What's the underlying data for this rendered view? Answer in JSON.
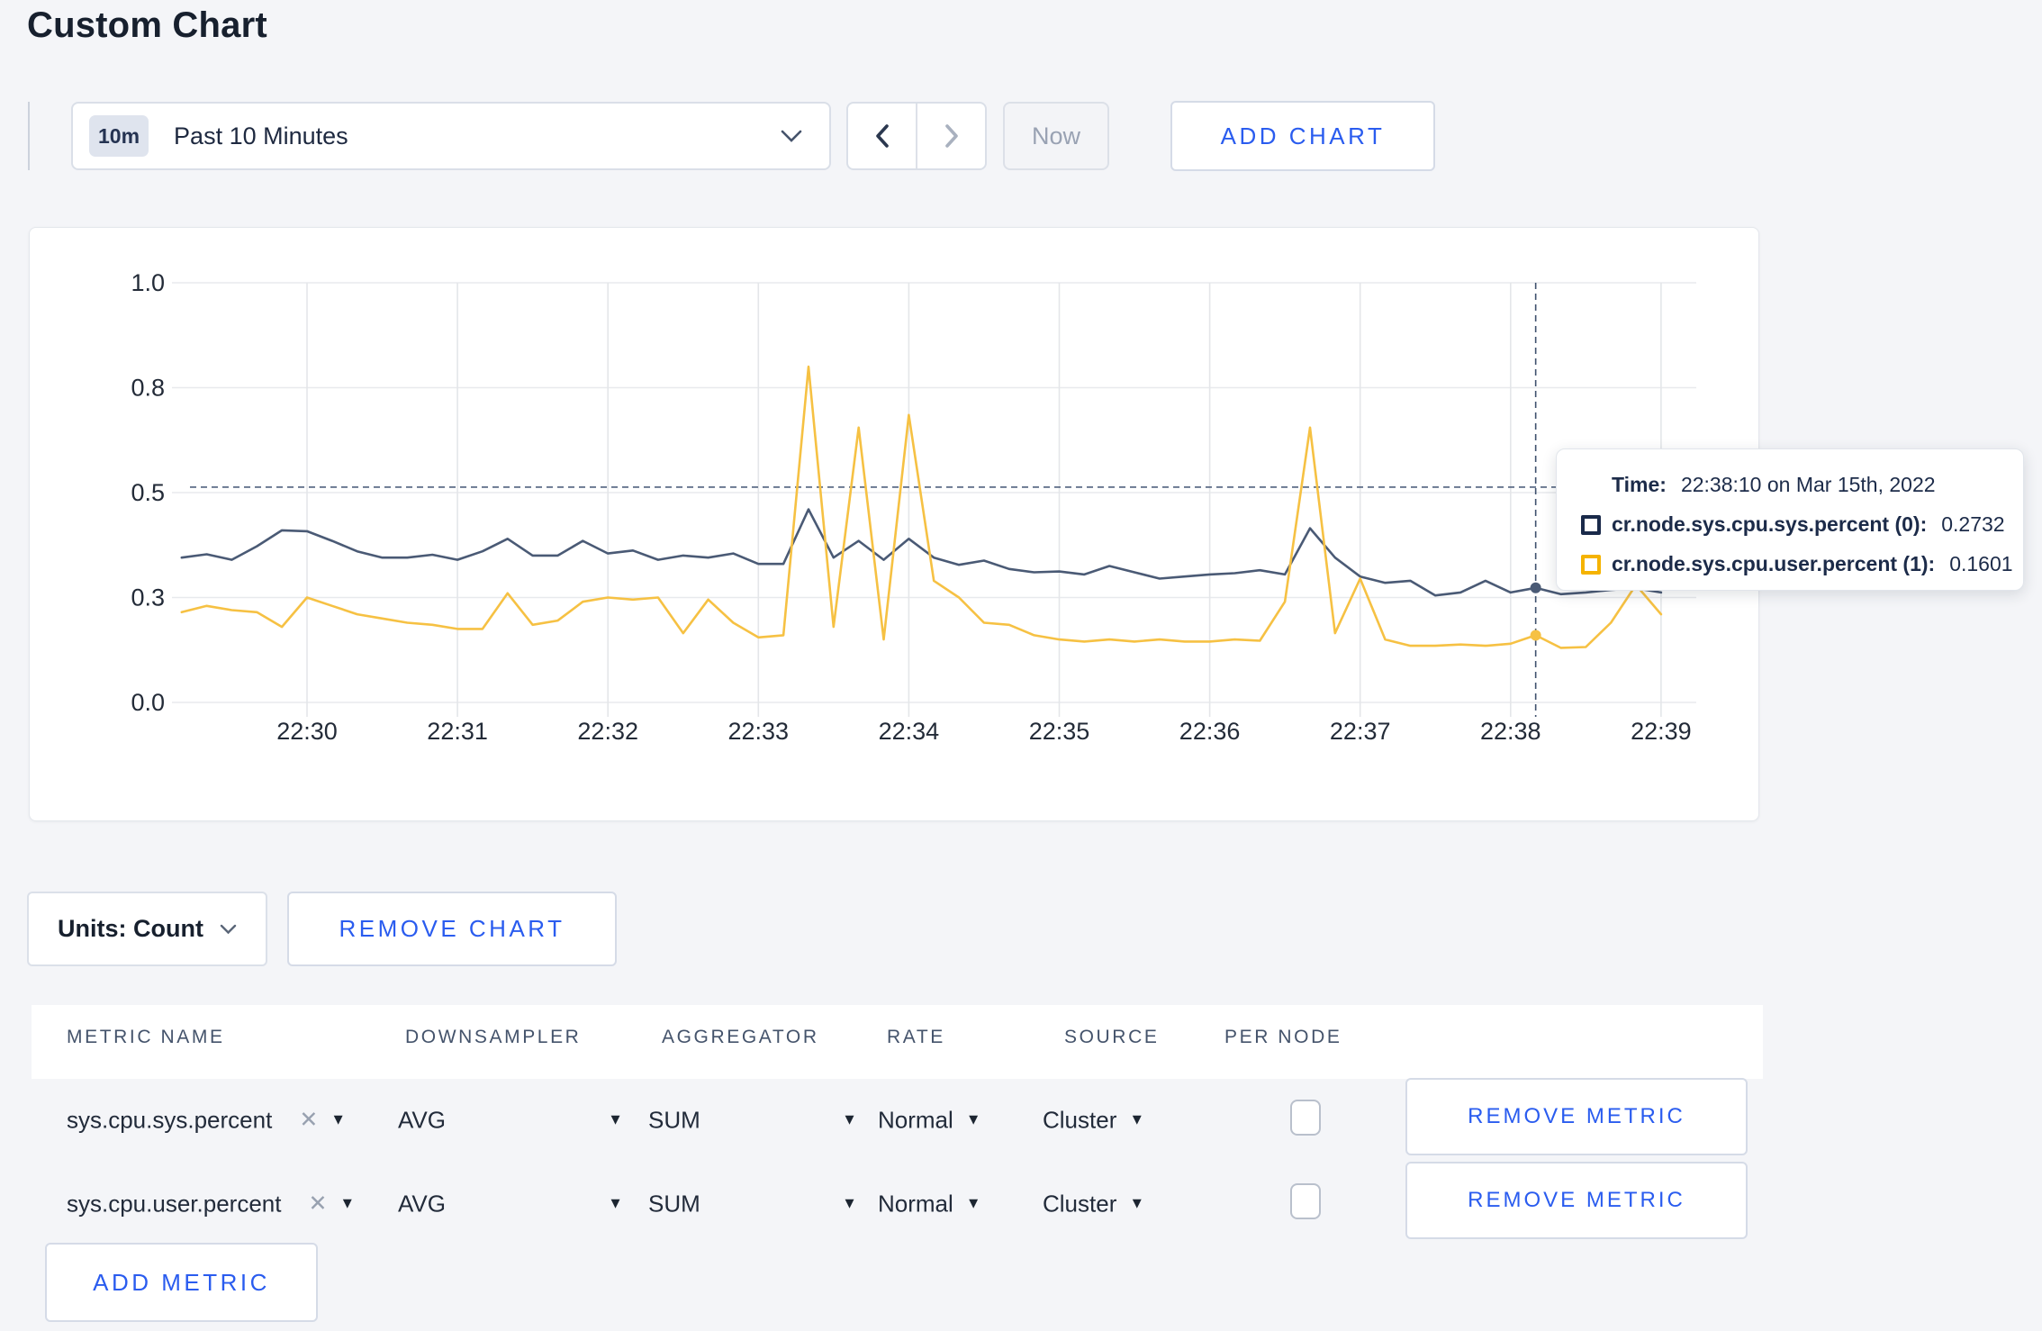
{
  "page": {
    "title": "Custom Chart",
    "background_color": "#f4f5f8",
    "accent_blue": "#2a5cef"
  },
  "toolbar": {
    "time_window_badge": "10m",
    "time_window_label": "Past 10 Minutes",
    "prev_label": "previous time window",
    "next_label": "next time window",
    "now_button": "Now",
    "add_chart_button": "ADD CHART"
  },
  "chart_data": {
    "type": "line",
    "title": "",
    "xlabel": "",
    "ylabel": "",
    "ylim": [
      0,
      1
    ],
    "grid": true,
    "y_ticks": {
      "values": [
        0,
        0.25,
        0.5,
        0.75,
        1
      ],
      "labels": [
        "0.0",
        "0.3",
        "0.5",
        "0.8",
        "1.0"
      ]
    },
    "x_ticks": [
      "22:30",
      "22:31",
      "22:32",
      "22:33",
      "22:34",
      "22:35",
      "22:36",
      "22:37",
      "22:38",
      "22:39"
    ],
    "x_start": "22:29:10",
    "x_interval_seconds": 10,
    "series": [
      {
        "name": "cr.node.sys.cpu.sys.percent",
        "color": "#4a5a75",
        "values": [
          0.345,
          0.353,
          0.34,
          0.372,
          0.41,
          0.408,
          0.385,
          0.36,
          0.345,
          0.345,
          0.352,
          0.34,
          0.36,
          0.39,
          0.35,
          0.35,
          0.385,
          0.355,
          0.362,
          0.34,
          0.35,
          0.345,
          0.355,
          0.33,
          0.33,
          0.46,
          0.345,
          0.385,
          0.34,
          0.39,
          0.345,
          0.328,
          0.338,
          0.318,
          0.31,
          0.312,
          0.305,
          0.325,
          0.31,
          0.295,
          0.3,
          0.305,
          0.308,
          0.315,
          0.305,
          0.415,
          0.345,
          0.3,
          0.285,
          0.29,
          0.255,
          0.262,
          0.29,
          0.262,
          0.273,
          0.258,
          0.262,
          0.268,
          0.272,
          0.262
        ]
      },
      {
        "name": "cr.node.sys.cpu.user.percent",
        "color": "#f6c143",
        "values": [
          0.215,
          0.23,
          0.22,
          0.215,
          0.18,
          0.25,
          0.23,
          0.21,
          0.2,
          0.19,
          0.185,
          0.175,
          0.175,
          0.26,
          0.185,
          0.195,
          0.24,
          0.25,
          0.245,
          0.25,
          0.165,
          0.245,
          0.19,
          0.155,
          0.16,
          0.8,
          0.18,
          0.655,
          0.15,
          0.685,
          0.29,
          0.25,
          0.19,
          0.185,
          0.16,
          0.15,
          0.145,
          0.15,
          0.145,
          0.15,
          0.145,
          0.145,
          0.15,
          0.147,
          0.24,
          0.655,
          0.165,
          0.295,
          0.15,
          0.135,
          0.135,
          0.138,
          0.135,
          0.14,
          0.16,
          0.13,
          0.132,
          0.19,
          0.28,
          0.21
        ]
      }
    ],
    "hover": {
      "index": 54,
      "time": "22:38:10",
      "crosshair_y_value": 0.513
    },
    "legend_position": "tooltip"
  },
  "tooltip": {
    "time_label": "Time:",
    "time_value": "22:38:10 on Mar 15th, 2022",
    "rows": [
      {
        "label": "cr.node.sys.cpu.sys.percent (0):",
        "value": "0.2732",
        "swatch_color": "#1a2a4a"
      },
      {
        "label": "cr.node.sys.cpu.user.percent (1):",
        "value": "0.1601",
        "swatch_color": "#f5b300"
      }
    ]
  },
  "chart_footer": {
    "units_label": "Units: Count",
    "remove_chart_button": "REMOVE CHART"
  },
  "metrics_table": {
    "headers": [
      "METRIC NAME",
      "DOWNSAMPLER",
      "AGGREGATOR",
      "RATE",
      "SOURCE",
      "PER NODE"
    ],
    "rows": [
      {
        "metric_name": "sys.cpu.sys.percent",
        "downsampler": "AVG",
        "aggregator": "SUM",
        "rate": "Normal",
        "source": "Cluster",
        "per_node_checked": false,
        "remove_button": "REMOVE METRIC"
      },
      {
        "metric_name": "sys.cpu.user.percent",
        "downsampler": "AVG",
        "aggregator": "SUM",
        "rate": "Normal",
        "source": "Cluster",
        "per_node_checked": false,
        "remove_button": "REMOVE METRIC"
      }
    ],
    "add_metric_button": "ADD METRIC"
  }
}
